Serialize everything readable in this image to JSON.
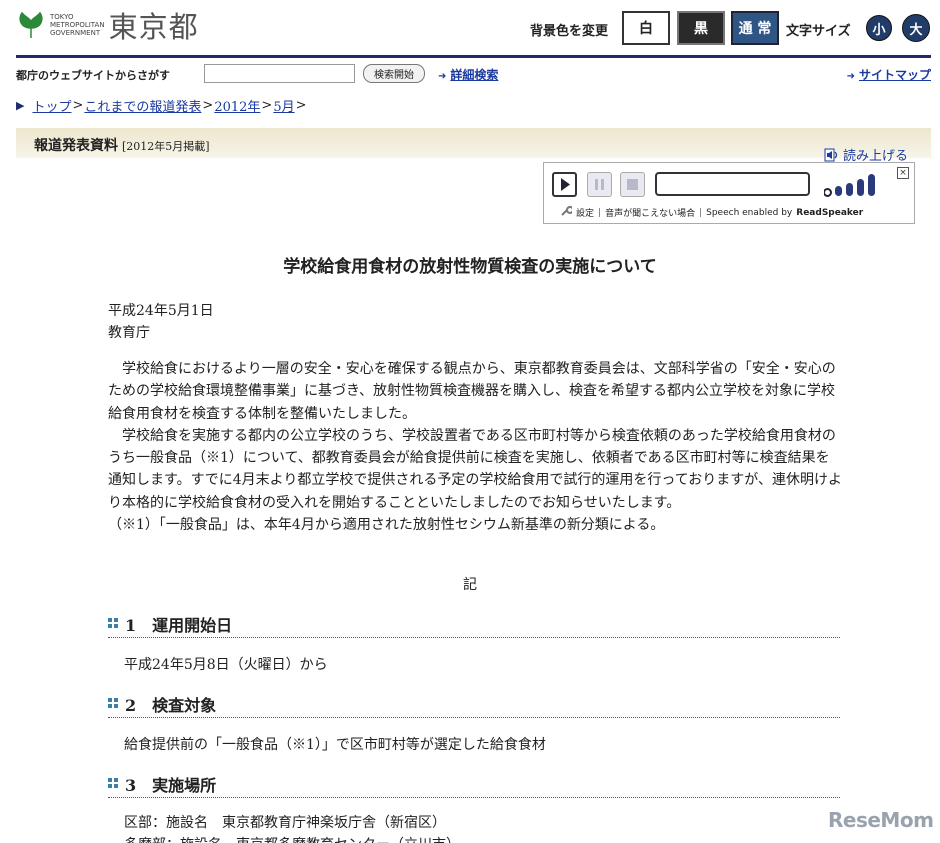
{
  "header": {
    "logo_small": [
      "TOKYO",
      "METROPOLITAN",
      "GOVERNMENT"
    ],
    "logo_big": "東京都",
    "bg_label": "背景色を変更",
    "bg_white": "白",
    "bg_black": "黒",
    "bg_normal": "通 常",
    "font_size_label": "文字サイズ",
    "font_small": "小",
    "font_large": "大",
    "brand_color": "#1f2b6b"
  },
  "search": {
    "label": "都庁のウェブサイトからさがす",
    "input_value": "",
    "button": "検索開始",
    "advanced": "詳細検索",
    "sitemap": "サイトマップ"
  },
  "breadcrumb": {
    "items": [
      "トップ",
      "これまでの報道発表",
      "2012年",
      "5月"
    ],
    "sep": ">"
  },
  "press": {
    "title": "報道発表資料",
    "sub": "[2012年5月掲載]"
  },
  "readspeaker": {
    "link": "読み上げる",
    "close": "×",
    "settings": "設定",
    "no_audio": "音声が聞こえない場合",
    "enabled_by": "Speech enabled by",
    "brand": "ReadSpeaker"
  },
  "article": {
    "title": "学校給食用食材の放射性物質検査の実施について",
    "date": "平成24年5月1日",
    "org": "教育庁",
    "paragraphs": [
      "学校給食におけるより一層の安全・安心を確保する観点から、東京都教育委員会は、文部科学省の「安全・安心のための学校給食環境整備事業」に基づき、放射性物質検査機器を購入し、検査を希望する都内公立学校を対象に学校給食用食材を検査する体制を整備いたしました。",
      "学校給食を実施する都内の公立学校のうち、学校設置者である区市町村等から検査依頼のあった学校給食用食材のうち一般食品（※1）について、都教育委員会が給食提供前に検査を実施し、依頼者である区市町村等に検査結果を通知します。すでに4月末より都立学校で提供される予定の学校給食用で試行的運用を行っておりますが、連休明けより本格的に学校給食食材の受入れを開始することといたしましたのでお知らせいたします。"
    ],
    "note": "（※1）「一般食品」は、本年4月から適用された放射性セシウム新基準の新分類による。",
    "ki": "記",
    "sections": [
      {
        "title": "1　運用開始日",
        "body": [
          "平成24年5月8日（火曜日）から"
        ]
      },
      {
        "title": "2　検査対象",
        "body": [
          "給食提供前の「一般食品（※1）」で区市町村等が選定した給食食材"
        ]
      },
      {
        "title": "3　実施場所",
        "body": [
          "区部：施設名　東京都教育庁神楽坂庁舎（新宿区）",
          "多摩部：施設名　東京都多摩教育センター（立川市）"
        ]
      }
    ]
  },
  "watermark": "ReseMom"
}
